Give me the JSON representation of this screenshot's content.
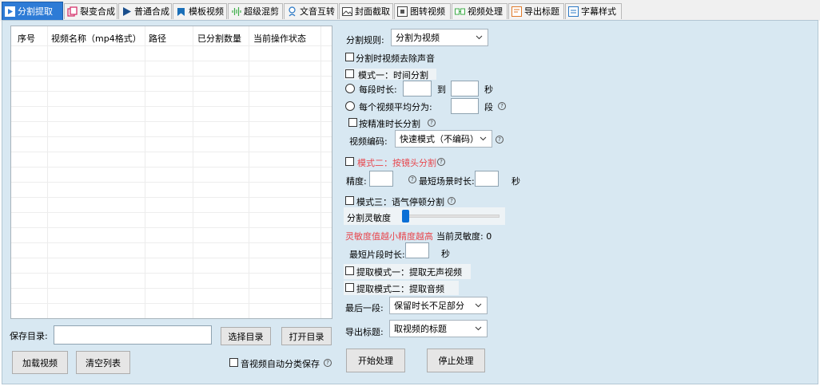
{
  "tabs": [
    {
      "label": "分割提取",
      "icon": "split-icon",
      "active": true
    },
    {
      "label": "裂变合成",
      "icon": "copy-icon",
      "active": false
    },
    {
      "label": "普通合成",
      "icon": "play-icon",
      "active": false
    },
    {
      "label": "模板视频",
      "icon": "bookmark-icon",
      "active": false
    },
    {
      "label": "超级混剪",
      "icon": "waveform-icon",
      "active": false
    },
    {
      "label": "文音互转",
      "icon": "speaker-icon",
      "active": false
    },
    {
      "label": "封面截取",
      "icon": "image-icon",
      "active": false
    },
    {
      "label": "图转视频",
      "icon": "picture-frame-icon",
      "active": false
    },
    {
      "label": "视频处理",
      "icon": "video-process-icon",
      "active": false
    },
    {
      "label": "导出标题",
      "icon": "export-title-icon",
      "active": false
    },
    {
      "label": "字幕样式",
      "icon": "subtitle-icon",
      "active": false
    }
  ],
  "list": {
    "columns": [
      "序号",
      "视频名称（mp4格式）",
      "路径",
      "已分割数量",
      "当前操作状态"
    ]
  },
  "bottom": {
    "save_dir_label": "保存目录:",
    "save_dir_value": "",
    "choose_dir": "选择目录",
    "open_dir": "打开目录",
    "load_video": "加载视频",
    "clear_list": "清空列表",
    "auto_classify": "音视频自动分类保存"
  },
  "settings": {
    "split_rule_label": "分割规则:",
    "split_rule_value": "分割为视频",
    "mute_on_split": "分割时视频去除声音",
    "mode1": "模式一：时间分割",
    "per_segment_label": "每段时长:",
    "per_segment_from": "",
    "to_label": "到",
    "per_segment_to": "",
    "seconds_label": "秒",
    "avg_split_label": "每个视频平均分为:",
    "avg_split_value": "",
    "segments_label": "段",
    "precise_split": "按精准时长分割",
    "video_codec_label": "视频编码:",
    "video_codec_value": "快速模式（不编码）",
    "mode2": "模式二：按镜头分割",
    "precision_label": "精度:",
    "precision_value": "",
    "min_scene_label": "最短场景时长:",
    "min_scene_value": "",
    "seconds_label2": "秒",
    "mode3": "模式三：语气停顿分割",
    "sensitivity_label": "分割灵敏度",
    "sensitivity_level": 0.0,
    "sensitivity_hint": "灵敏度值越小精度越高",
    "current_sensitivity": "当前灵敏度: 0",
    "min_segment_label": "最短片段时长:",
    "min_segment_value": "",
    "seconds_label3": "秒",
    "extract_mode1": "提取模式一：提取无声视频",
    "extract_mode2": "提取模式二：提取音频",
    "last_segment_label": "最后一段:",
    "last_segment_value": "保留时长不足部分",
    "export_title_label": "导出标题:",
    "export_title_value": "取视频的标题",
    "start": "开始处理",
    "stop": "停止处理"
  },
  "colors": {
    "active_tab": "#2d7bd6",
    "panel_bg": "#d8e8f2",
    "red_text": "#e8474e",
    "slider_thumb": "#0a6fd6"
  }
}
